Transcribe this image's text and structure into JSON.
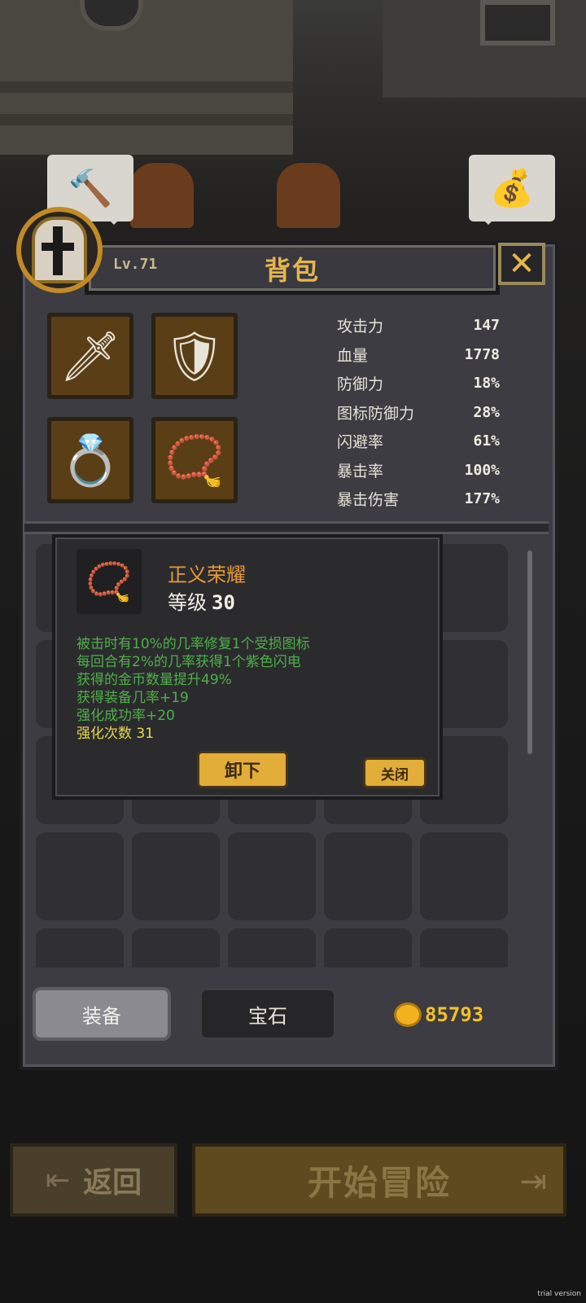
{
  "header": {
    "level": "Lv.71",
    "title": "背包",
    "close_glyph": "✕"
  },
  "equipment": [
    {
      "name": "sword",
      "glyph": "🗡"
    },
    {
      "name": "armor",
      "glyph": "🛡"
    },
    {
      "name": "ring",
      "glyph": "💍"
    },
    {
      "name": "necklace",
      "glyph": "📿"
    }
  ],
  "stats": [
    {
      "label": "攻击力",
      "value": "147"
    },
    {
      "label": "血量",
      "value": "1778"
    },
    {
      "label": "防御力",
      "value": "18%"
    },
    {
      "label": "图标防御力",
      "value": "28%"
    },
    {
      "label": "闪避率",
      "value": "61%"
    },
    {
      "label": "暴击率",
      "value": "100%"
    },
    {
      "label": "暴击伤害",
      "value": "177%"
    }
  ],
  "tooltip": {
    "item_name": "正义荣耀",
    "level_label": "等级",
    "level_value": "30",
    "effects": [
      "被击时有10%的几率修复1个受损图标",
      "每回合有2%的几率获得1个紫色闪电",
      "获得的金币数量提升49%",
      "获得装备几率+19",
      "强化成功率+20"
    ],
    "enhance_count": "强化次数 31",
    "unequip_label": "卸下",
    "close_label": "关闭"
  },
  "tabs": {
    "equipment": "装备",
    "gems": "宝石"
  },
  "gold": "85793",
  "footer": {
    "back_label": "返回",
    "start_label": "开始冒险"
  },
  "watermark": "trial version",
  "colors": {
    "accent_gold": "#e6b64c",
    "effect_green": "#4fb049",
    "effect_yellow": "#e7d94a",
    "item_name_orange": "#e89a36"
  }
}
